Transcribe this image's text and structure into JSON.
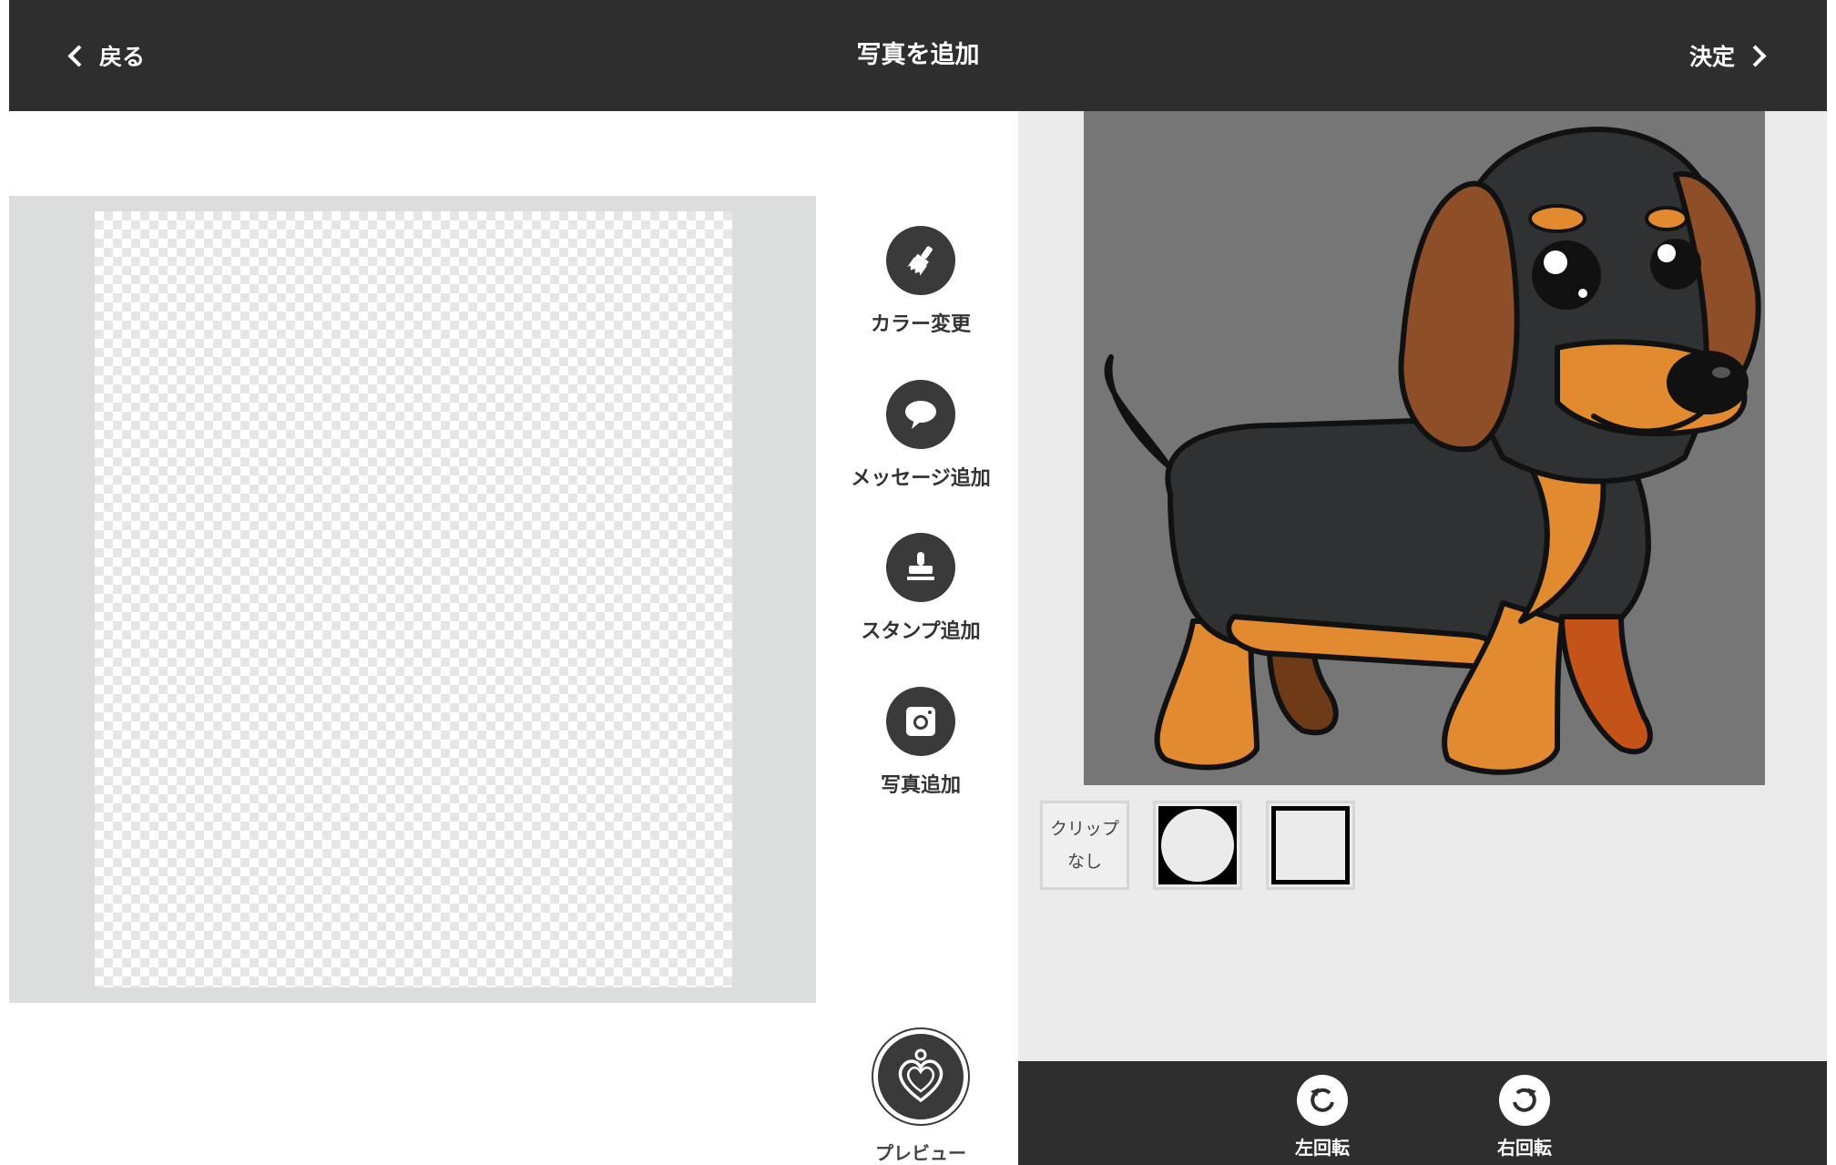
{
  "header": {
    "title": "写真を追加",
    "back_label": "戻る",
    "next_label": "決定"
  },
  "tools": [
    {
      "label": "カラー変更",
      "icon": "brush-icon"
    },
    {
      "label": "メッセージ追加",
      "icon": "speech-bubble-icon"
    },
    {
      "label": "スタンプ追加",
      "icon": "stamp-icon"
    },
    {
      "label": "写真追加",
      "icon": "camera-icon"
    }
  ],
  "preview": {
    "label": "プレビュー",
    "icon": "heart-tag-icon"
  },
  "clip": {
    "none_line1": "クリップ",
    "none_line2": "なし",
    "circle_icon": "circle-clip-icon",
    "square_icon": "square-clip-icon"
  },
  "rotate": {
    "left_label": "左回転",
    "right_label": "右回転"
  },
  "colors": {
    "header_bg": "#2e2e2e",
    "tool_circle": "#3a3a3a",
    "right_panel_bg": "#ebebeb",
    "photo_bg": "#767676",
    "canvas_frame": "#dcdddd"
  }
}
